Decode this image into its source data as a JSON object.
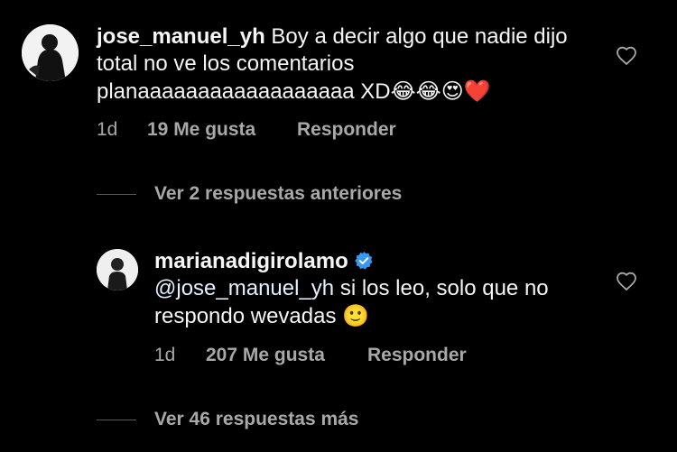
{
  "comments": [
    {
      "username": "jose_manuel_yh",
      "text": "Boy a decir algo que nadie dijo total no ve los comentarios planaaaaaaaaaaaaaaaaaa XD",
      "emojis": "😂😂😍❤️",
      "time": "1d",
      "likes": "19 Me gusta",
      "reply": "Responder",
      "verified": false
    },
    {
      "username": "marianadigirolamo",
      "mention": "@jose_manuel_yh",
      "text": "si los leo, solo que no respondo wevadas",
      "emojis": "🙂",
      "time": "1d",
      "likes": "207 Me gusta",
      "reply": "Responder",
      "verified": true
    }
  ],
  "replies": {
    "previous": "Ver 2 respuestas anteriores",
    "more": "Ver 46 respuestas más"
  },
  "colors": {
    "background": "#000000",
    "text": "#f5f5f5",
    "meta": "#a8a8a8",
    "verified": "#3897f0"
  },
  "icons": {
    "like": "heart-outline-icon",
    "verified": "verified-badge-icon"
  }
}
